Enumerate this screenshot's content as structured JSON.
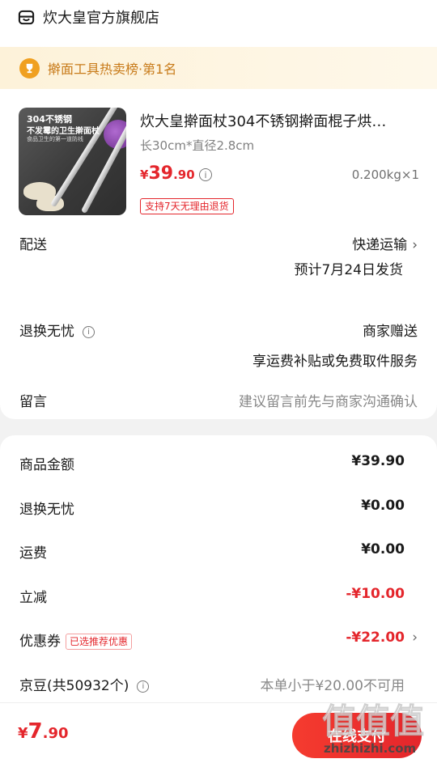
{
  "store": {
    "name": "炊大皇官方旗舰店",
    "icon": "store-icon"
  },
  "rank": {
    "text": "擀面工具热卖榜·第1名",
    "icon": "trophy-icon"
  },
  "product": {
    "title": "炊大皇擀面杖304不锈钢擀面棍子烘…",
    "spec": "长30cm*直径2.8cm",
    "price_symbol": "¥",
    "price_int": "39",
    "price_dec": ".90",
    "weight_qty": "0.200kg×1",
    "return_badge": "支持7天无理由退货",
    "thumb_line1": "304不锈钢",
    "thumb_line2": "不发霉的卫生擀面杖",
    "thumb_line3": "食品卫生的第一道防线"
  },
  "delivery": {
    "label": "配送",
    "method": "快递运输",
    "eta": "预计7月24日发货"
  },
  "returns": {
    "label": "退换无忧",
    "value": "商家赠送",
    "desc": "享运费补贴或免费取件服务"
  },
  "note": {
    "label": "留言",
    "placeholder": "建议留言前先与商家沟通确认"
  },
  "summary": {
    "goods_amount": {
      "label": "商品金额",
      "value": "¥39.90"
    },
    "returns_fee": {
      "label": "退换无忧",
      "value": "¥0.00"
    },
    "shipping": {
      "label": "运费",
      "value": "¥0.00"
    },
    "discount": {
      "label": "立减",
      "value": "-¥10.00"
    },
    "coupon": {
      "label": "优惠券",
      "badge": "已选推荐优惠",
      "value": "-¥22.00"
    },
    "jingdou": {
      "label": "京豆(共50932个)",
      "value": "本单小于¥20.00不可用"
    }
  },
  "footer": {
    "total_symbol": "¥",
    "total_int": "7",
    "total_dec": ".90",
    "pay_label": "在线支付"
  },
  "watermark": {
    "main": "值值值",
    "sub": "zhizhizhi.com"
  },
  "colors": {
    "accent_red": "#e4262c",
    "rank_gold": "#c87b1a",
    "rank_bg": "#fdf2d9"
  }
}
